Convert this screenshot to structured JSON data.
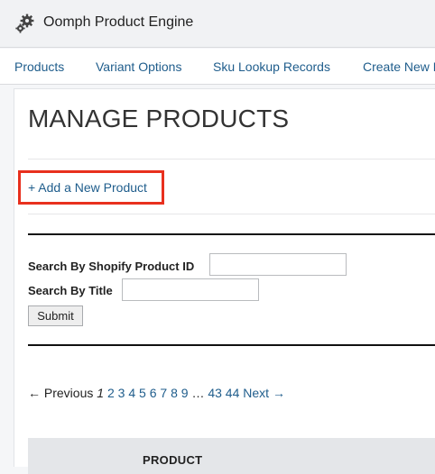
{
  "app": {
    "title": "Oomph Product Engine",
    "icon": "gears-icon"
  },
  "nav": {
    "items": [
      {
        "label": "Products"
      },
      {
        "label": "Variant Options"
      },
      {
        "label": "Sku Lookup Records"
      },
      {
        "label": "Create New P"
      }
    ]
  },
  "page": {
    "title": "MANAGE PRODUCTS",
    "add_link": "+ Add a New Product"
  },
  "search": {
    "shopify_id_label": "Search By Shopify Product ID",
    "shopify_id_value": "",
    "title_label": "Search By Title",
    "title_value": "",
    "submit_label": "Submit"
  },
  "pagination": {
    "previous": "← Previous",
    "current": "1",
    "pages": [
      "2",
      "3",
      "4",
      "5",
      "6",
      "7",
      "8",
      "9"
    ],
    "ellipsis": "…",
    "last_pages": [
      "43",
      "44"
    ],
    "next": "Next →"
  },
  "table": {
    "columns": [
      "PRODUCT"
    ]
  },
  "colors": {
    "link": "#1f5d8c",
    "highlight": "#e8301e"
  }
}
